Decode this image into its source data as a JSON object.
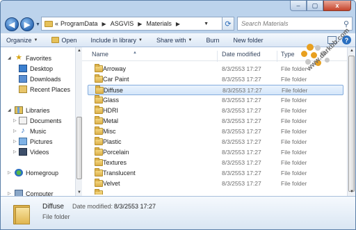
{
  "window": {
    "controls": {
      "minimize": "–",
      "maximize": "▢",
      "close": "x"
    }
  },
  "navigation": {
    "back_glyph": "◀",
    "forward_glyph": "▶",
    "breadcrumb_prefix": "«",
    "breadcrumbs": [
      "ProgramData",
      "ASGVIS",
      "Materials"
    ],
    "search_placeholder": "Search Materials"
  },
  "toolbar": {
    "organize": "Organize",
    "open": "Open",
    "include_in_library": "Include in library",
    "share_with": "Share with",
    "burn": "Burn",
    "new_folder": "New folder",
    "help_glyph": "?"
  },
  "sidebar": {
    "favorites": "Favorites",
    "favorites_items": [
      "Desktop",
      "Downloads",
      "Recent Places"
    ],
    "libraries": "Libraries",
    "libraries_items": [
      "Documents",
      "Music",
      "Pictures",
      "Videos"
    ],
    "homegroup": "Homegroup",
    "computer": "Computer"
  },
  "columns": {
    "name": "Name",
    "date_modified": "Date modified",
    "type": "Type"
  },
  "files": [
    {
      "name": "Arroway",
      "date": "8/3/2553 17:27",
      "type": "File folder"
    },
    {
      "name": "Car Paint",
      "date": "8/3/2553 17:27",
      "type": "File folder"
    },
    {
      "name": "Diffuse",
      "date": "8/3/2553 17:27",
      "type": "File folder",
      "selected": true
    },
    {
      "name": "Glass",
      "date": "8/3/2553 17:27",
      "type": "File folder"
    },
    {
      "name": "HDRI",
      "date": "8/3/2553 17:27",
      "type": "File folder"
    },
    {
      "name": "Metal",
      "date": "8/3/2553 17:27",
      "type": "File folder"
    },
    {
      "name": "Misc",
      "date": "8/3/2553 17:27",
      "type": "File folder"
    },
    {
      "name": "Plastic",
      "date": "8/3/2553 17:27",
      "type": "File folder"
    },
    {
      "name": "Porcelain",
      "date": "8/3/2553 17:27",
      "type": "File folder"
    },
    {
      "name": "Textures",
      "date": "8/3/2553 17:27",
      "type": "File folder"
    },
    {
      "name": "Translucent",
      "date": "8/3/2553 17:27",
      "type": "File folder"
    },
    {
      "name": "Velvet",
      "date": "8/3/2553 17:27",
      "type": "File folder"
    }
  ],
  "details": {
    "name": "Diffuse",
    "date_label": "Date modified:",
    "date_value": "8/3/2553 17:27",
    "type": "File folder"
  },
  "watermark": {
    "text": "www.darkbb.com"
  },
  "colors": {
    "accent": "#2a6fc0",
    "folder": "#e0b650",
    "selection": "#d3e6fa",
    "watermark": "#e8a020"
  }
}
